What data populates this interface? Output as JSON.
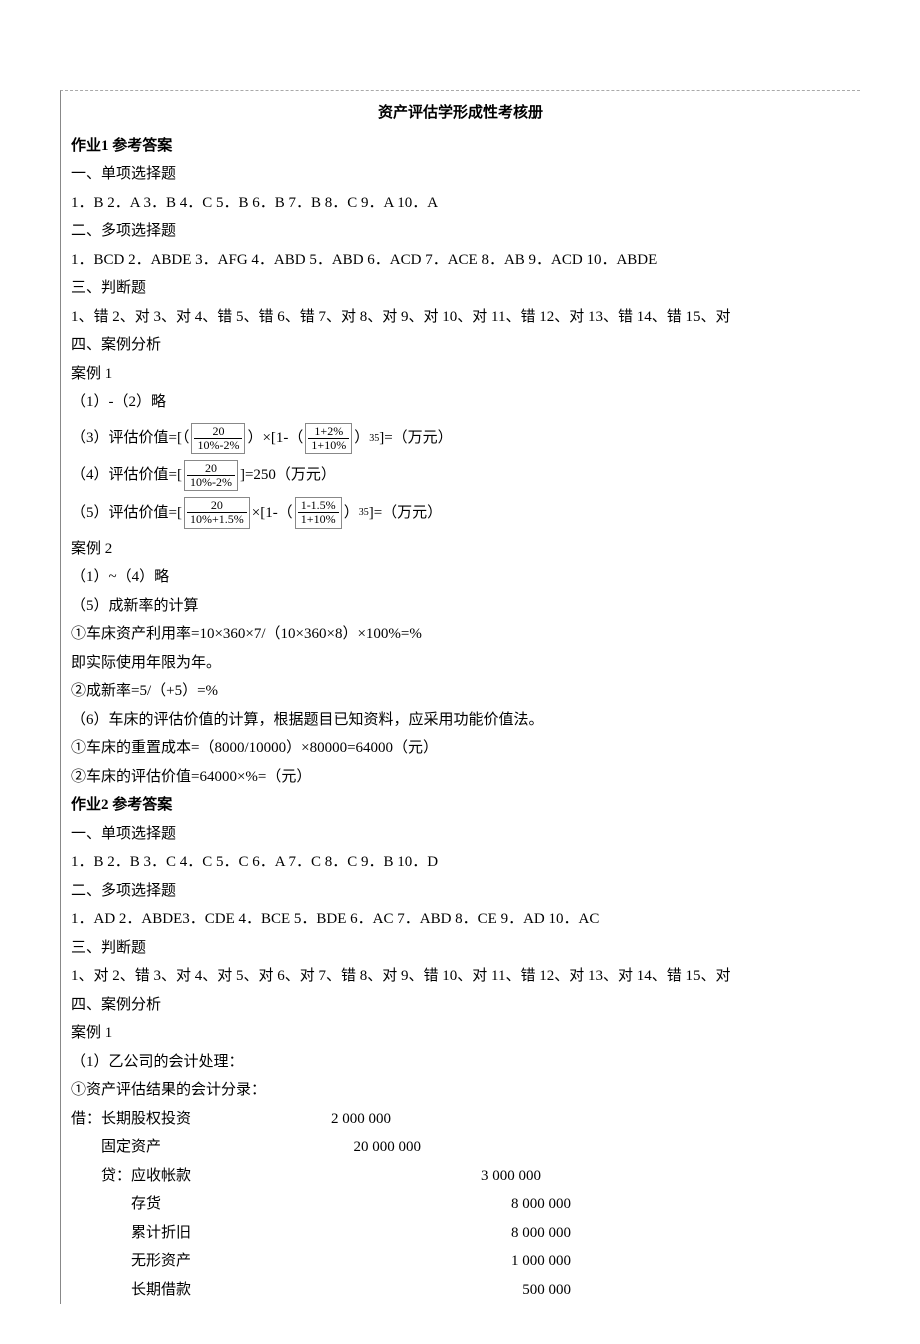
{
  "title": "资产评估学形成性考核册",
  "hw1": {
    "heading": "作业1  参考答案",
    "sec1_header": "一、单项选择题",
    "sec1_answers": "1．B 2．A 3．B 4．C 5．B  6．B 7．B 8．C 9．A 10．A",
    "sec2_header": "二、多项选择题",
    "sec2_answers": "1．BCD  2．ABDE 3．AFG  4．ABD  5．ABD 6．ACD 7．ACE 8．AB 9．ACD 10．ABDE",
    "sec3_header": "三、判断题",
    "sec3_answers": "1、错 2、对 3、对 4、错 5、错 6、错 7、对 8、对 9、对 10、对 11、错 12、对 13、错 14、错 15、对",
    "sec4_header": "四、案例分析",
    "case1_label": "案例 1",
    "case1_l1": "（1）-（2）略",
    "f3_prefix": "（3）评估价值=[（",
    "f3_frac1_num": "20",
    "f3_frac1_den": "10%-2%",
    "f3_mid1": "）×[1-（",
    "f3_frac2_num": "1+2%",
    "f3_frac2_den": "1+10%",
    "f3_suffix": "）",
    "f3_sub": "35",
    "f3_tail": "]=（万元）",
    "f4_prefix": "（4）评估价值=[",
    "f4_frac_num": "20",
    "f4_frac_den": "10%-2%",
    "f4_suffix": "]=250（万元）",
    "f5_prefix": "（5）评估价值=[",
    "f5_frac1_num": "20",
    "f5_frac1_den": "10%+1.5%",
    "f5_mid1": "×[1-（",
    "f5_frac2_num": "1-1.5%",
    "f5_frac2_den": "1+10%",
    "f5_suffix": "）",
    "f5_sub": "35",
    "f5_tail": "]=（万元）",
    "case2_label": "案例 2",
    "case2_l1": "（1）~（4）略",
    "case2_l2": "（5）成新率的计算",
    "case2_l3": "①车床资产利用率=10×360×7/（10×360×8）×100%=%",
    "case2_l4": "即实际使用年限为年。",
    "case2_l5": "②成新率=5/（+5）=%",
    "case2_l6": "（6）车床的评估价值的计算，根据题目已知资料，应采用功能价值法。",
    "case2_l7": "①车床的重置成本=（8000/10000）×80000=64000（元）",
    "case2_l8": "②车床的评估价值=64000×%=（元）"
  },
  "hw2": {
    "heading": "作业2  参考答案",
    "sec1_header": "一、单项选择题",
    "sec1_answers": "1．B 2．B 3．C 4．C 5．C  6．A 7．C 8．C 9．B 10．D",
    "sec2_header": "二、多项选择题",
    "sec2_answers": "1．AD  2．ABDE3．CDE  4．BCE  5．BDE 6．AC 7．ABD 8．CE 9．AD 10．AC",
    "sec3_header": "三、判断题",
    "sec3_answers": "1、对 2、错 3、对 4、对 5、对 6、对 7、错 8、对 9、错 10、对 11、错 12、对 13、对 14、错 15、对",
    "sec4_header": "四、案例分析",
    "case1_label": "案例 1",
    "case1_l1": "（1）乙公司的会计处理：",
    "case1_l2": "①资产评估结果的会计分录：",
    "entries": [
      {
        "label": "借：长期股权投资",
        "amount": "2 000 000",
        "indent": 0,
        "wide": false
      },
      {
        "label": "固定资产",
        "amount": "20 000 000",
        "indent": 1,
        "wide": false
      },
      {
        "label": "贷：应收帐款",
        "amount": "3 000 000",
        "indent": 1,
        "wide": true
      },
      {
        "label": "存货",
        "amount": "8 000 000",
        "indent": 2,
        "wide": true
      },
      {
        "label": "累计折旧",
        "amount": "8 000 000",
        "indent": 2,
        "wide": true
      },
      {
        "label": "无形资产",
        "amount": "1 000 000",
        "indent": 2,
        "wide": true
      },
      {
        "label": "长期借款",
        "amount": "500 000",
        "indent": 2,
        "wide": true
      }
    ]
  }
}
